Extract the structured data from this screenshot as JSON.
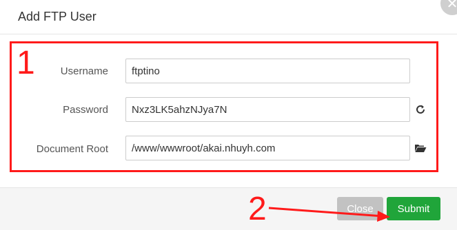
{
  "dialog": {
    "title": "Add FTP User",
    "close_icon": "close-icon"
  },
  "form": {
    "username": {
      "label": "Username",
      "value": "ftptino"
    },
    "password": {
      "label": "Password",
      "value": "Nxz3LK5ahzNJya7N",
      "icon": "refresh-icon"
    },
    "document_root": {
      "label": "Document Root",
      "value": "/www/wwwroot/akai.nhuyh.com",
      "icon": "folder-open-icon"
    }
  },
  "footer": {
    "close_label": "Close",
    "submit_label": "Submit"
  },
  "annotations": {
    "box_label": "1",
    "arrow_label": "2",
    "color": "#ff1a1a"
  },
  "colors": {
    "submit": "#20a53a",
    "close": "#c2c2c2"
  }
}
